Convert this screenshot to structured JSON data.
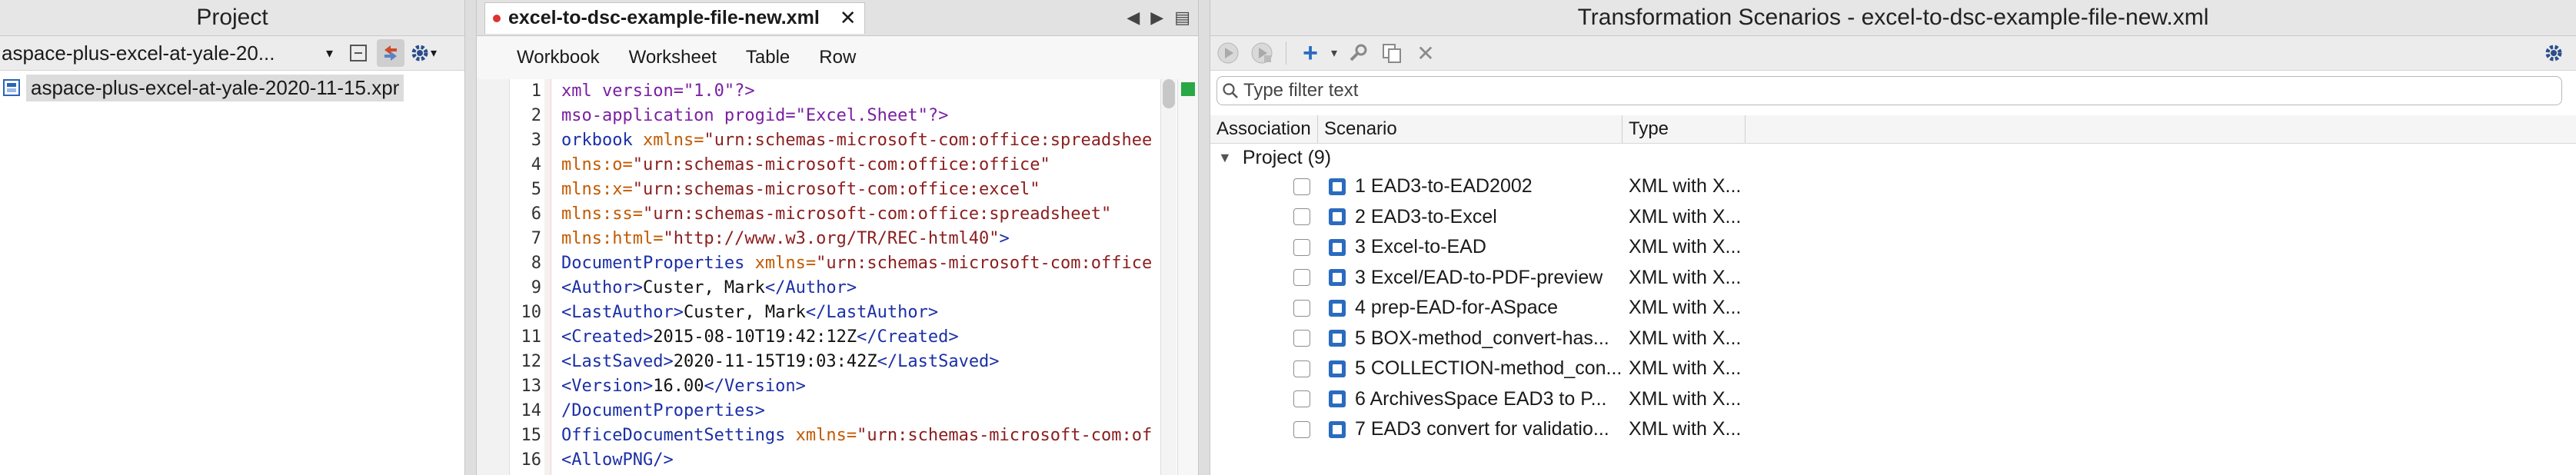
{
  "project": {
    "title": "Project",
    "selected_project": "aspace-plus-excel-at-yale-20...",
    "tree_item": "aspace-plus-excel-at-yale-2020-11-15.xpr"
  },
  "editor": {
    "tab_label": "excel-to-dsc-example-file-new.xml",
    "breadcrumbs": [
      "Workbook",
      "Worksheet",
      "Table",
      "Row"
    ],
    "line_numbers": [
      "1",
      "2",
      "3",
      "4",
      "5",
      "6",
      "7",
      "8",
      "9",
      "10",
      "11",
      "12",
      "13",
      "14",
      "15",
      "16"
    ]
  },
  "scenarios": {
    "title": "Transformation Scenarios - excel-to-dsc-example-file-new.xml",
    "filter_placeholder": "Type filter text",
    "columns": {
      "association": "Association",
      "scenario": "Scenario",
      "type": "Type"
    },
    "group_label": "Project (9)",
    "rows": [
      {
        "name": "1 EAD3-to-EAD2002",
        "type": "XML with X..."
      },
      {
        "name": "2 EAD3-to-Excel",
        "type": "XML with X..."
      },
      {
        "name": "3 Excel-to-EAD",
        "type": "XML with X..."
      },
      {
        "name": "3 Excel/EAD-to-PDF-preview",
        "type": "XML with X..."
      },
      {
        "name": "4 prep-EAD-for-ASpace",
        "type": "XML with X..."
      },
      {
        "name": "5 BOX-method_convert-has...",
        "type": "XML with X..."
      },
      {
        "name": "5 COLLECTION-method_con...",
        "type": "XML with X..."
      },
      {
        "name": "6 ArchivesSpace EAD3 to P...",
        "type": "XML with X..."
      },
      {
        "name": "7 EAD3 convert for validatio...",
        "type": "XML with X..."
      }
    ]
  }
}
